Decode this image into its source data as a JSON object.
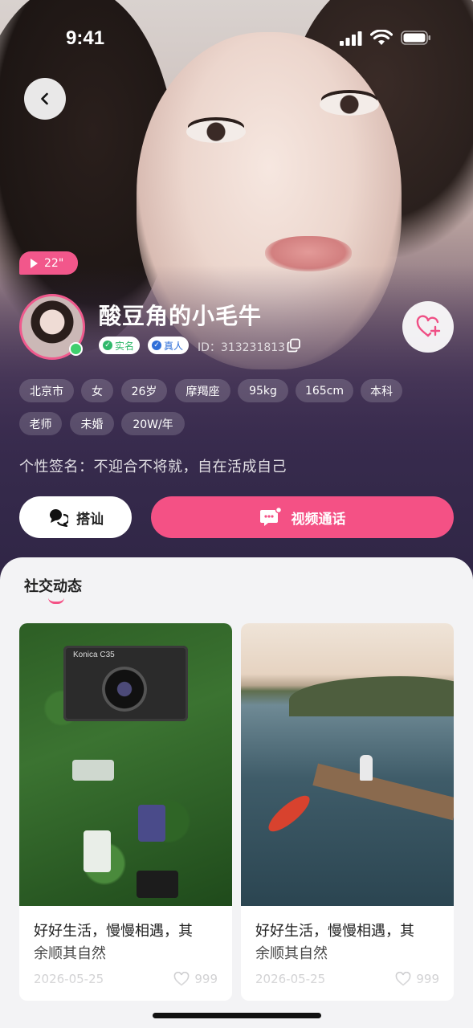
{
  "status_bar": {
    "time": "9:41"
  },
  "profile": {
    "video_duration": "22\"",
    "nickname": "酸豆角的小毛牛",
    "badges": {
      "real_name": "实名",
      "real_person": "真人"
    },
    "id_label": "ID：313231813",
    "tags": [
      "北京市",
      "女",
      "26岁",
      "摩羯座",
      "95kg",
      "165cm",
      "本科",
      "老师",
      "未婚",
      "20W/年"
    ],
    "signature": "个性签名：不迎合不将就，自在活成自己",
    "greet_label": "搭讪",
    "video_call_label": "视频通话"
  },
  "feed": {
    "title": "社交动态",
    "posts": [
      {
        "caption_line1": "好好生活，慢慢相遇，其",
        "caption_line2": "余顺其自然",
        "date": "2026-05-25",
        "likes": "999",
        "camera_brand": "Konica C35"
      },
      {
        "caption_line1": "好好生活，慢慢相遇，其",
        "caption_line2": "余顺其自然",
        "date": "2026-05-25",
        "likes": "999"
      }
    ]
  },
  "colors": {
    "accent": "#f45185",
    "online": "#3fcf6d",
    "real_name_green": "#2fb86a",
    "real_person_blue": "#2f6fd8"
  }
}
